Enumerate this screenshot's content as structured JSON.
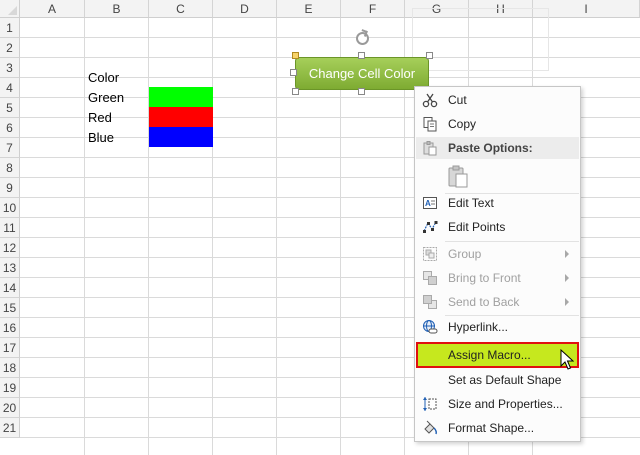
{
  "columns": [
    "A",
    "B",
    "C",
    "D",
    "E",
    "F",
    "G",
    "H",
    "I"
  ],
  "rows": [
    "1",
    "2",
    "3",
    "4",
    "5",
    "6",
    "7",
    "8",
    "9",
    "10",
    "11",
    "12",
    "13",
    "14",
    "15",
    "16",
    "17",
    "18",
    "19",
    "20",
    "21"
  ],
  "cells": {
    "b3": "Color",
    "b4": "Green",
    "b5": "Red",
    "b6": "Blue"
  },
  "swatches": {
    "green": "#00ff00",
    "red": "#ff0000",
    "blue": "#0000ff"
  },
  "shape": {
    "label": "Change Cell Color"
  },
  "menu": {
    "cut": "Cut",
    "copy": "Copy",
    "paste_options": "Paste Options:",
    "edit_text": "Edit Text",
    "edit_points": "Edit Points",
    "group": "Group",
    "bring_to_front": "Bring to Front",
    "send_to_back": "Send to Back",
    "hyperlink": "Hyperlink...",
    "assign_macro": "Assign Macro...",
    "set_default_shape": "Set as Default Shape",
    "size_properties": "Size and Properties...",
    "format_shape": "Format Shape..."
  },
  "colors": {
    "highlight": "#c6e81e",
    "highlight_border": "#e01010",
    "shape_fill": "#8dba3f"
  }
}
